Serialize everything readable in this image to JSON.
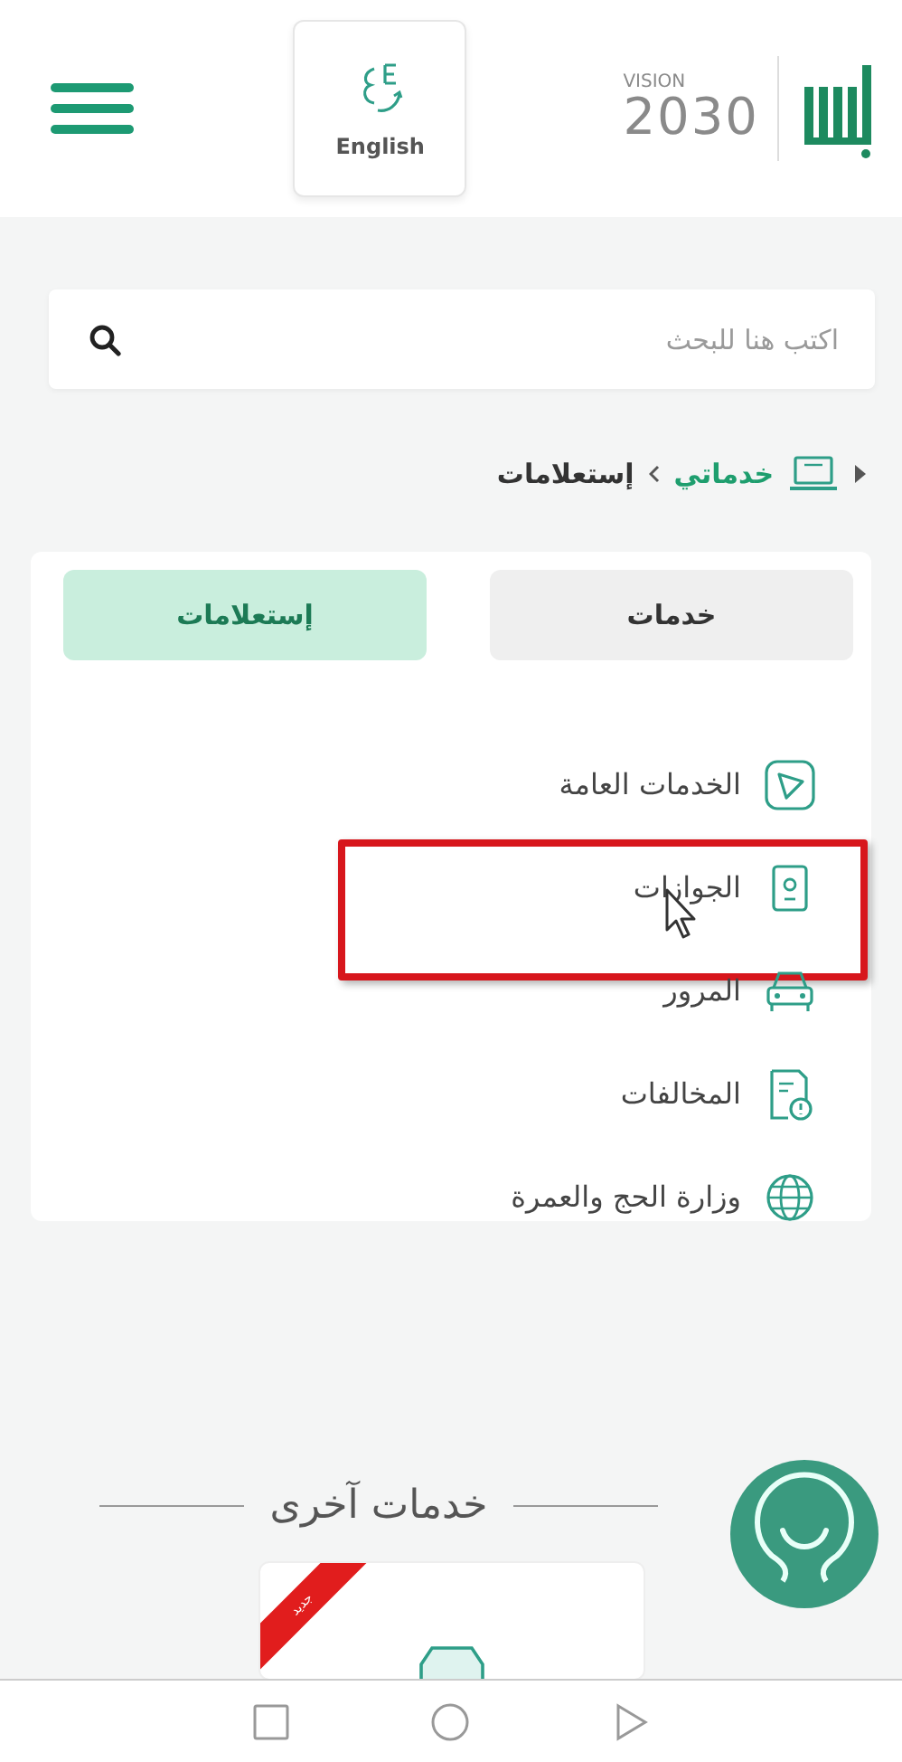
{
  "header": {
    "language_button": {
      "label": "English"
    },
    "vision_logo": {
      "top": "VISION",
      "number": "2030"
    }
  },
  "search": {
    "placeholder": "اكتب هنا للبحث"
  },
  "breadcrumb": [
    {
      "label": "خدماتي",
      "kind": "link"
    },
    {
      "label": "إستعلامات",
      "kind": "current"
    }
  ],
  "tabs": [
    {
      "label": "خدمات",
      "selected": false
    },
    {
      "label": "إستعلامات",
      "selected": true
    }
  ],
  "services": [
    {
      "label": "الخدمات العامة",
      "kind": "play",
      "highlighted": false
    },
    {
      "label": "الجوازات",
      "kind": "passport",
      "highlighted": true
    },
    {
      "label": "المرور",
      "kind": "car",
      "highlighted": false
    },
    {
      "label": "المخالفات",
      "kind": "violation",
      "highlighted": false
    },
    {
      "label": "وزارة الحج والعمرة",
      "kind": "globe",
      "highlighted": false
    }
  ],
  "other_services": {
    "title": "خدمات آخرى",
    "cards": [
      {
        "badge": "جديد"
      }
    ]
  }
}
